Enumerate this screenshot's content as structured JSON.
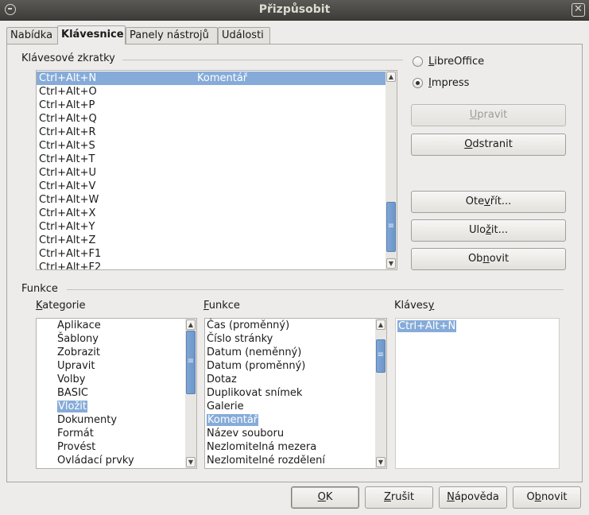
{
  "window": {
    "title": "Přizpůsobit"
  },
  "tabs": [
    {
      "label": "Nabídka"
    },
    {
      "label": "Klávesnice"
    },
    {
      "label": "Panely nástrojů"
    },
    {
      "label": "Události"
    }
  ],
  "shortcuts": {
    "section_label": "Klávesové zkratky",
    "rows": [
      {
        "key": "Ctrl+Alt+N",
        "command": "Komentář"
      },
      {
        "key": "Ctrl+Alt+O",
        "command": ""
      },
      {
        "key": "Ctrl+Alt+P",
        "command": ""
      },
      {
        "key": "Ctrl+Alt+Q",
        "command": ""
      },
      {
        "key": "Ctrl+Alt+R",
        "command": ""
      },
      {
        "key": "Ctrl+Alt+S",
        "command": ""
      },
      {
        "key": "Ctrl+Alt+T",
        "command": ""
      },
      {
        "key": "Ctrl+Alt+U",
        "command": ""
      },
      {
        "key": "Ctrl+Alt+V",
        "command": ""
      },
      {
        "key": "Ctrl+Alt+W",
        "command": ""
      },
      {
        "key": "Ctrl+Alt+X",
        "command": ""
      },
      {
        "key": "Ctrl+Alt+Y",
        "command": ""
      },
      {
        "key": "Ctrl+Alt+Z",
        "command": ""
      },
      {
        "key": "Ctrl+Alt+F1",
        "command": ""
      },
      {
        "key": "Ctrl+Alt+F2",
        "command": ""
      }
    ]
  },
  "scope": {
    "libreoffice_label": "LibreOffice",
    "impress_label": "Impress",
    "selected": "Impress"
  },
  "buttons": {
    "modify": "Upravit",
    "delete": "Odstranit",
    "load": "Otevřít...",
    "save": "Uložit...",
    "reset": "Obnovit"
  },
  "functions": {
    "section_label": "Funkce",
    "category_label": "Kategorie",
    "function_label": "Funkce",
    "keys_label": "Klávesy",
    "categories": [
      "Aplikace",
      "Šablony",
      "Zobrazit",
      "Upravit",
      "Volby",
      "BASIC",
      "Vložit",
      "Dokumenty",
      "Formát",
      "Provést",
      "Ovládací prvky"
    ],
    "selected_category": "Vložit",
    "function_items": [
      "Čas (proměnný)",
      "Číslo stránky",
      "Datum (neměnný)",
      "Datum (proměnný)",
      "Dotaz",
      "Duplikovat snímek",
      "Galerie",
      "Komentář",
      "Název souboru",
      "Nezlomitelná mezera",
      "Nezlomitelné rozdělení"
    ],
    "selected_function": "Komentář",
    "keys": [
      "Ctrl+Alt+N"
    ]
  },
  "footer": {
    "ok": "OK",
    "cancel": "Zrušit",
    "help": "Nápověda",
    "reset": "Obnovit"
  },
  "colors": {
    "selection": "#86abd9",
    "titlebar": "#3d3c38",
    "dialog_bg": "#edeceb"
  }
}
